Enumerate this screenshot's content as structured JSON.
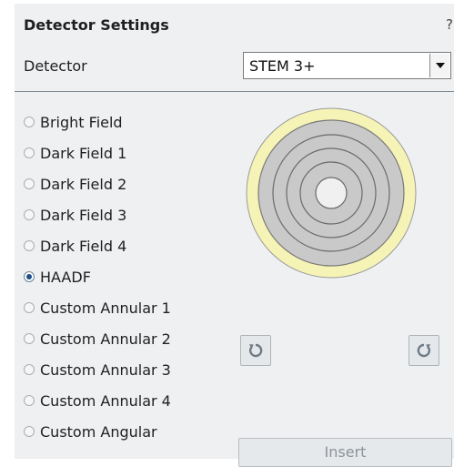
{
  "panel": {
    "title": "Detector Settings",
    "help_label": "?"
  },
  "detector": {
    "label": "Detector",
    "selected": "STEM 3+"
  },
  "modes": [
    {
      "label": "Bright Field",
      "selected": false
    },
    {
      "label": "Dark Field 1",
      "selected": false
    },
    {
      "label": "Dark Field 2",
      "selected": false
    },
    {
      "label": "Dark Field 3",
      "selected": false
    },
    {
      "label": "Dark Field 4",
      "selected": false
    },
    {
      "label": "HAADF",
      "selected": true
    },
    {
      "label": "Custom Annular 1",
      "selected": false
    },
    {
      "label": "Custom Annular 2",
      "selected": false
    },
    {
      "label": "Custom Annular 3",
      "selected": false
    },
    {
      "label": "Custom Annular 4",
      "selected": false
    },
    {
      "label": "Custom Angular",
      "selected": false
    }
  ],
  "diagram": {
    "outer_color": "#f6f3b6",
    "segment_color": "#c9c9c9",
    "center_color": "#f0f0f0",
    "ring_count": 5
  },
  "buttons": {
    "rotate_left_icon": "rotate-ccw-icon",
    "rotate_right_icon": "rotate-cw-icon",
    "insert_label": "Insert",
    "insert_enabled": false
  }
}
